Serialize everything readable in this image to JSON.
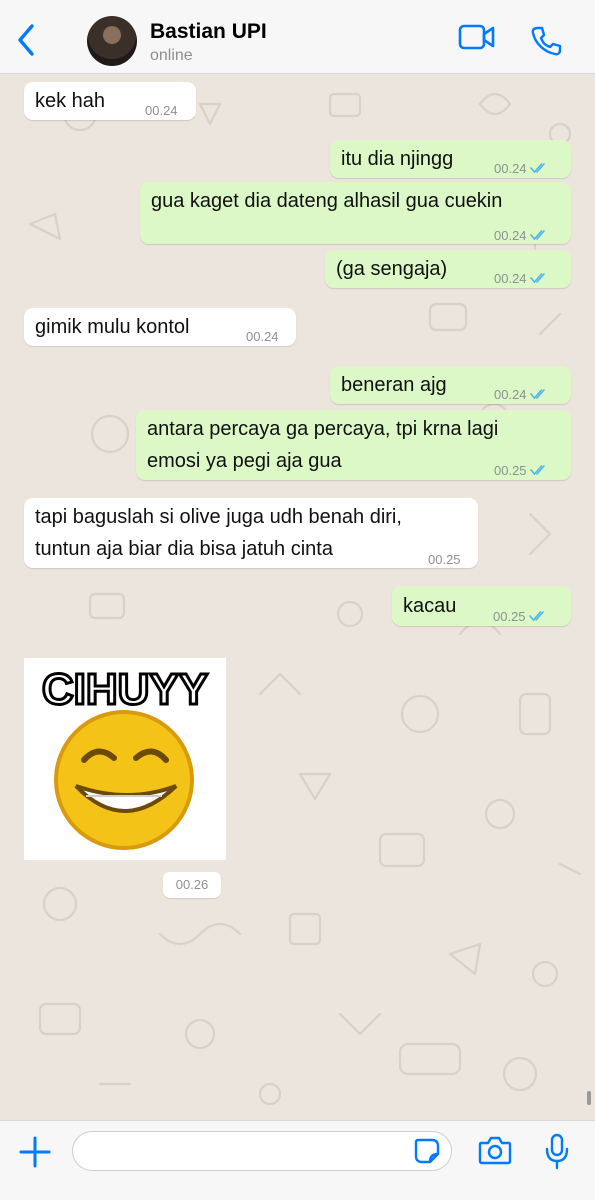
{
  "header": {
    "contact_name": "Bastian UPI",
    "status": "online",
    "back_icon": "chevron-left-icon",
    "video_icon": "video-call-icon",
    "call_icon": "phone-icon",
    "accent_color": "#007aff"
  },
  "messages": [
    {
      "dir": "in",
      "lines": [
        "kek hah"
      ],
      "time": "00.24"
    },
    {
      "dir": "out",
      "lines": [
        "itu dia njingg"
      ],
      "time": "00.24",
      "status": "read"
    },
    {
      "dir": "out",
      "lines": [
        "gua kaget dia dateng alhasil gua cuekin"
      ],
      "time": "00.24",
      "status": "read"
    },
    {
      "dir": "out",
      "lines": [
        "(ga sengaja)"
      ],
      "time": "00.24",
      "status": "read"
    },
    {
      "dir": "in",
      "lines": [
        "gimik mulu kontol"
      ],
      "time": "00.24"
    },
    {
      "dir": "out",
      "lines": [
        "beneran ajg"
      ],
      "time": "00.24",
      "status": "read"
    },
    {
      "dir": "out",
      "lines": [
        "antara percaya ga percaya, tpi krna lagi",
        "emosi ya pegi aja gua"
      ],
      "time": "00.25",
      "status": "read"
    },
    {
      "dir": "in",
      "lines": [
        "tapi baguslah si olive juga udh benah diri,",
        "tuntun aja biar dia bisa jatuh cinta"
      ],
      "time": "00.25"
    },
    {
      "dir": "out",
      "lines": [
        "kacau"
      ],
      "time": "00.25",
      "status": "read"
    }
  ],
  "sticker": {
    "caption": "CIHUYY",
    "time": "00.26"
  },
  "composer": {
    "placeholder": "",
    "plus_icon": "plus-icon",
    "sticker_icon": "sticker-icon",
    "camera_icon": "camera-icon",
    "mic_icon": "microphone-icon"
  },
  "colors": {
    "outgoing_bubble": "#dcf8c6",
    "incoming_bubble": "#ffffff",
    "read_ticks": "#4fb6ec",
    "chat_background": "#ece5dd"
  }
}
